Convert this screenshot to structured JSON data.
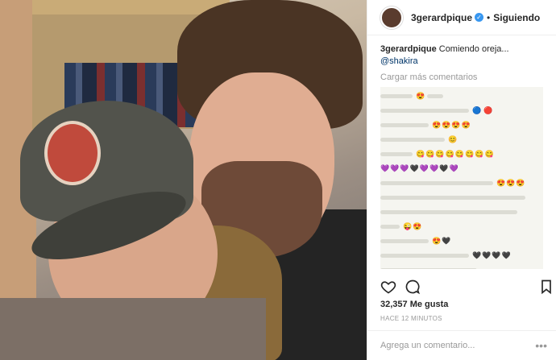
{
  "post": {
    "username": "3gerardpique",
    "follow_label": "Siguiendo",
    "caption_text": "Comiendo oreja...",
    "caption_mention": "@shakira",
    "load_more": "Cargar más comentarios",
    "likes": "32,357 Me gusta",
    "time": "HACE 12 MINUTOS",
    "comment_placeholder": "Agrega un comentario..."
  },
  "colors": {
    "verified": "#3897f0",
    "mention": "#003569"
  },
  "icons": [
    "heart-icon",
    "comment-icon",
    "bookmark-icon",
    "more-icon",
    "verified-icon"
  ]
}
